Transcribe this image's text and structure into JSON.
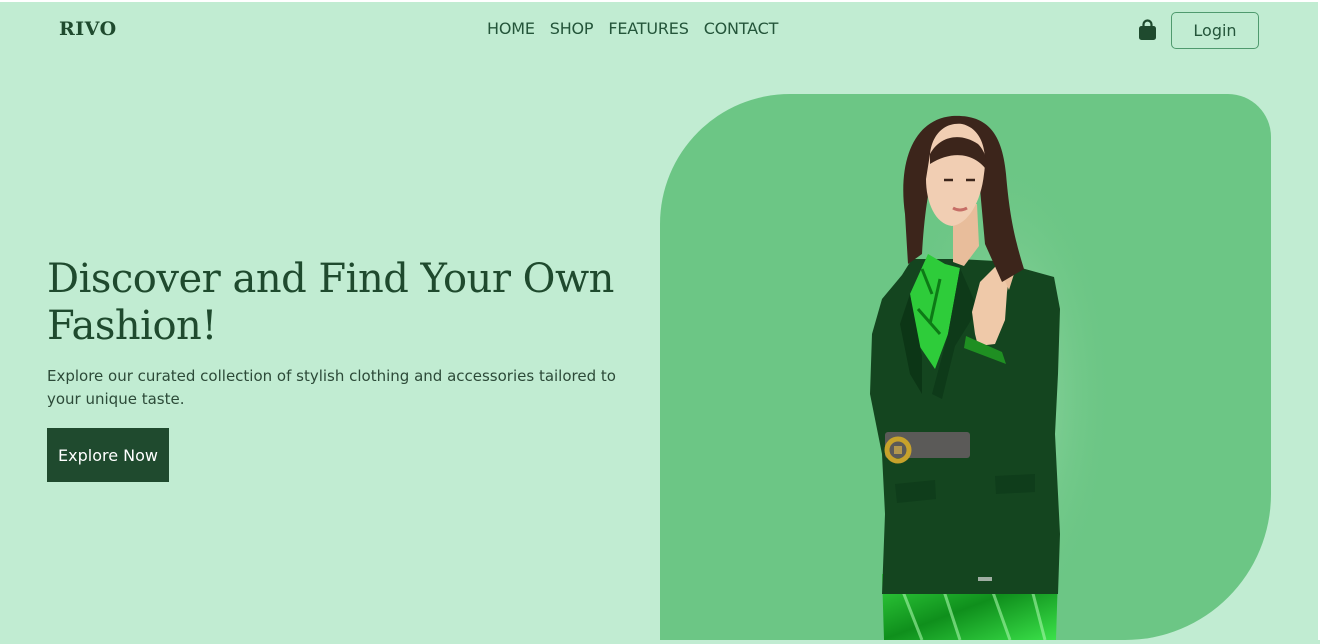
{
  "header": {
    "logo": "RIVO",
    "nav": [
      "HOME",
      "SHOP",
      "FEATURES",
      "CONTACT"
    ],
    "cart_icon": "shopping-bag-icon",
    "login_label": "Login"
  },
  "hero": {
    "title_line1": "Discover and Find Your Own",
    "title_line2": "Fashion!",
    "description": "Explore our curated collection of stylish clothing and accessories tailored to your unique taste.",
    "cta_label": "Explore Now",
    "image": "woman-in-green-blazer-photo"
  },
  "colors": {
    "background": "#c1ecd2",
    "accent_dark": "#1f4a2e",
    "hero_shape": "#6cc685",
    "blazer": "#14451f",
    "dress": "#1fbd2e"
  }
}
